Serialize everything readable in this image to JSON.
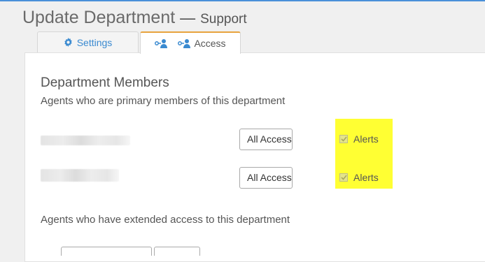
{
  "header": {
    "title": "Update Department",
    "separator": "—",
    "subtitle": "Support"
  },
  "tabs": [
    {
      "label": "Settings",
      "icon": "gear-icon",
      "active": false
    },
    {
      "label": "Access",
      "icon": "user-key-icon",
      "active": true
    }
  ],
  "members": {
    "title": "Department Members",
    "primary_description": "Agents who are primary members of this department",
    "rows": [
      {
        "access_value": "All Access",
        "alerts_label": "Alerts",
        "alerts_checked": true
      },
      {
        "access_value": "All Access",
        "alerts_label": "Alerts",
        "alerts_checked": true
      }
    ],
    "extended_description": "Agents who have extended access to this department"
  },
  "colors": {
    "accent": "#3a8ad0",
    "active_tab_border": "#e8a33d",
    "highlight": "#ffff33"
  }
}
